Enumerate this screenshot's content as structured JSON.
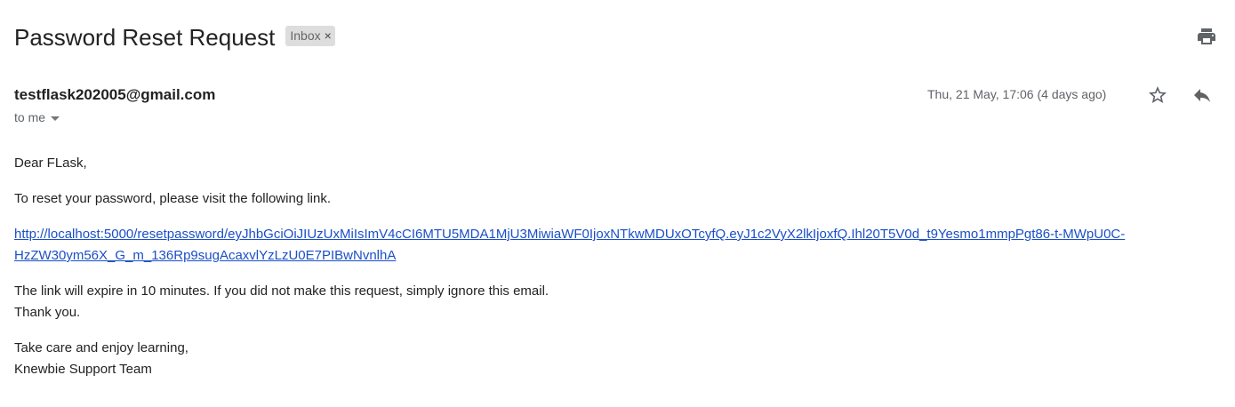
{
  "email": {
    "subject": "Password Reset Request",
    "label": "Inbox",
    "label_close": "×",
    "sender": "testflask202005@gmail.com",
    "recipient": "to me",
    "date": "Thu, 21 May, 17:06 (4 days ago)"
  },
  "icons": {
    "print": "print-icon",
    "star": "star-icon",
    "reply": "reply-icon",
    "dropdown": "chevron-down-icon"
  },
  "body": {
    "greeting": "Dear FLask,",
    "instruction": "To reset your password, please visit the following link.",
    "link_line1": "http://localhost:5000/resetpassword/eyJhbGciOiJIUzUxMiIsImV4cCI6MTU5MDA1MjU3MiwiaWF0IjoxNTkwMDUxOTcyfQ.eyJ1c2VyX2lkIjoxfQ.Ihl20T5V0d_t9Yesmo1mmpPgt86-t-MWpU0C-",
    "link_line2": "HzZW30ym56X_G_m_136Rp9sugAcaxvlYzLzU0E7PIBwNvnlhA",
    "expiry_line1": "The link will expire in 10 minutes. If you did not make this request, simply ignore this email.",
    "expiry_line2": "Thank you.",
    "signoff_line1": "Take care and enjoy learning,",
    "signoff_line2": "Knewbie Support Team"
  },
  "colors": {
    "link": "#1a4fc7",
    "chip_bg": "#dddddd",
    "muted": "#5f6368"
  }
}
